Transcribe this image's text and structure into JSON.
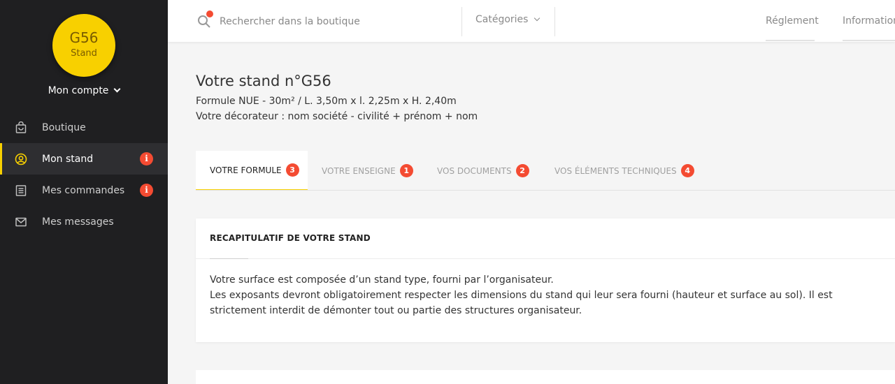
{
  "sidebar": {
    "avatar": {
      "code": "G56",
      "label": "Stand"
    },
    "account_label": "Mon compte",
    "items": [
      {
        "label": "Boutique",
        "icon": "shopping-bag-icon",
        "badge": ""
      },
      {
        "label": "Mon stand",
        "icon": "user-circle-icon",
        "badge": "i"
      },
      {
        "label": "Mes commandes",
        "icon": "list-document-icon",
        "badge": "i"
      },
      {
        "label": "Mes messages",
        "icon": "envelope-icon",
        "badge": ""
      }
    ]
  },
  "topbar": {
    "search_placeholder": "Rechercher dans la boutique",
    "categories_label": "Catégories",
    "links": [
      "Réglement",
      "Information"
    ]
  },
  "main": {
    "title": "Votre stand n°G56",
    "formula": "Formule NUE - 30m² / L. 3,50m x l. 2,25m x H. 2,40m",
    "decorator": "Votre décorateur : nom société - civilité + prénom + nom",
    "tabs": [
      {
        "label": "VOTRE FORMULE",
        "badge": "3"
      },
      {
        "label": "VOTRE ENSEIGNE",
        "badge": "1"
      },
      {
        "label": "VOS DOCUMENTS",
        "badge": "2"
      },
      {
        "label": "VOS ÉLÉMENTS TECHNIQUES",
        "badge": "4"
      }
    ],
    "card": {
      "header": "RECAPITULATIF DE VOTRE STAND",
      "line1": "Votre surface est composée d’un stand type, fourni par l’organisateur.",
      "line2": "Les exposants devront obligatoirement respecter les dimensions du stand qui leur sera fourni (hauteur et surface au sol). Il est strictement interdit de démonter tout ou partie des structures organisateur."
    }
  },
  "colors": {
    "accent": "#f8d000",
    "badge": "#f44b32",
    "sidebar_bg": "#1f1f21",
    "sidebar_active": "#2e2e31"
  }
}
